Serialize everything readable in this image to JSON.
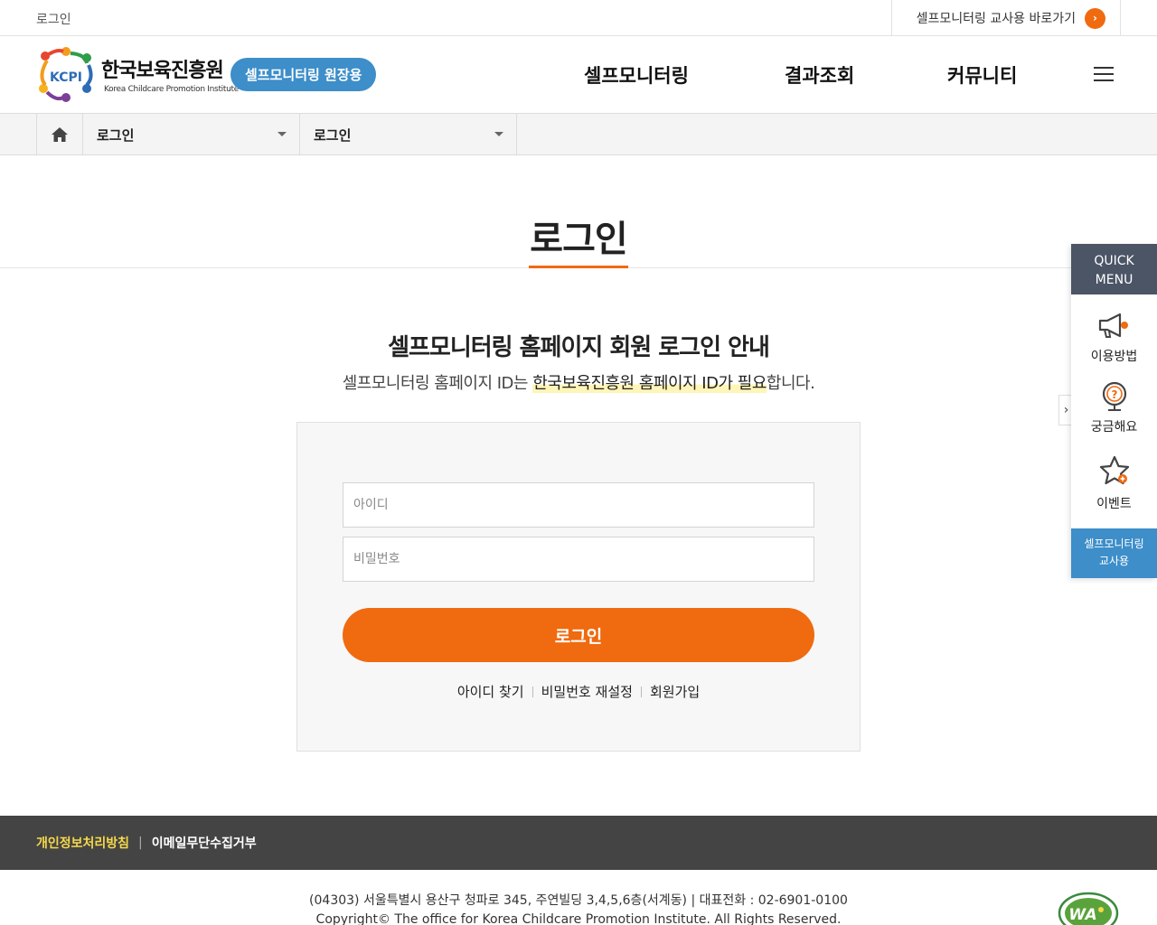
{
  "topbar": {
    "login_link": "로그인",
    "teacher_link": "셀프모니터링 교사용 바로가기",
    "go_icon": "›"
  },
  "header": {
    "logo_kr": "한국보육진흥원",
    "logo_en": "Korea Childcare Promotion Institute",
    "logo_mark_text": "KCPI",
    "site_badge": "셀프모니터링 원장용",
    "nav": [
      "셀프모니터링",
      "결과조회",
      "커뮤니티"
    ],
    "menu_icon": "hamburger-icon"
  },
  "location": {
    "home_icon": "home-icon",
    "depth1": "로그인",
    "depth2": "로그인"
  },
  "page": {
    "title": "로그인"
  },
  "login": {
    "heading": "셀프모니터링 홈페이지 회원 로그인 안내",
    "desc_before": "셀프모니터링 홈페이지 ID는 ",
    "desc_highlight": "한국보육진흥원 홈페이지 ID가 필요",
    "desc_after": "합니다.",
    "id_placeholder": "아이디",
    "id_value": "",
    "pw_placeholder": "비밀번호",
    "pw_value": "",
    "submit_label": "로그인",
    "links": {
      "find_id": "아이디 찾기",
      "reset_pw": "비밀번호 재설정",
      "signup": "회원가입"
    }
  },
  "quick_menu": {
    "head_line1": "QUICK",
    "head_line2": "MENU",
    "items": [
      "이용방법",
      "궁금해요",
      "이벤트"
    ],
    "icons": [
      "megaphone-icon",
      "question-globe-icon",
      "star-icon"
    ],
    "foot_line1": "셀프모니터링",
    "foot_line2": "교사용",
    "toggle": "›"
  },
  "footer": {
    "privacy": "개인정보처리방침",
    "separator": "|",
    "email_refusal": "이메일무단수집거부",
    "address": "(04303) 서울특별시 용산구 청파로 345, 주연빌딩 3,4,5,6층(서계동) | 대표전화 : 02-6901-0100",
    "copyright": "Copyright© The office for Korea Childcare Promotion Institute. All Rights Reserved.",
    "wa_mark_text": "WA"
  },
  "colors": {
    "accent": "#f06a0f",
    "brand_blue": "#3d8ec9",
    "quick_head": "#4b5566",
    "footer_bg": "#444444",
    "footer_highlight": "#f5d94a"
  }
}
